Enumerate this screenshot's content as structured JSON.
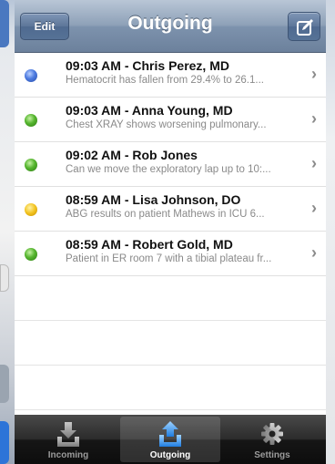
{
  "nav": {
    "title": "Outgoing",
    "edit_label": "Edit",
    "compose_icon": "compose-icon"
  },
  "messages": [
    {
      "status_color": "#4d7be0",
      "title": "09:03 AM - Chris Perez, MD",
      "preview": "Hematocrit has fallen from 29.4% to 26.1..."
    },
    {
      "status_color": "#55b52e",
      "title": "09:03 AM - Anna Young, MD",
      "preview": "Chest XRAY shows worsening pulmonary..."
    },
    {
      "status_color": "#55b52e",
      "title": "09:02 AM - Rob Jones",
      "preview": "Can we move the exploratory lap up to 10:..."
    },
    {
      "status_color": "#f2c21e",
      "title": "08:59 AM - Lisa Johnson, DO",
      "preview": "ABG results on patient Mathews in ICU 6..."
    },
    {
      "status_color": "#55b52e",
      "title": "08:59 AM - Robert Gold, MD",
      "preview": "Patient in ER room 7 with a tibial plateau fr..."
    }
  ],
  "tabs": [
    {
      "label": "Incoming",
      "icon": "inbox-download-icon",
      "active": false
    },
    {
      "label": "Outgoing",
      "icon": "outbox-upload-icon",
      "active": true
    },
    {
      "label": "Settings",
      "icon": "gear-icon",
      "active": false
    }
  ]
}
